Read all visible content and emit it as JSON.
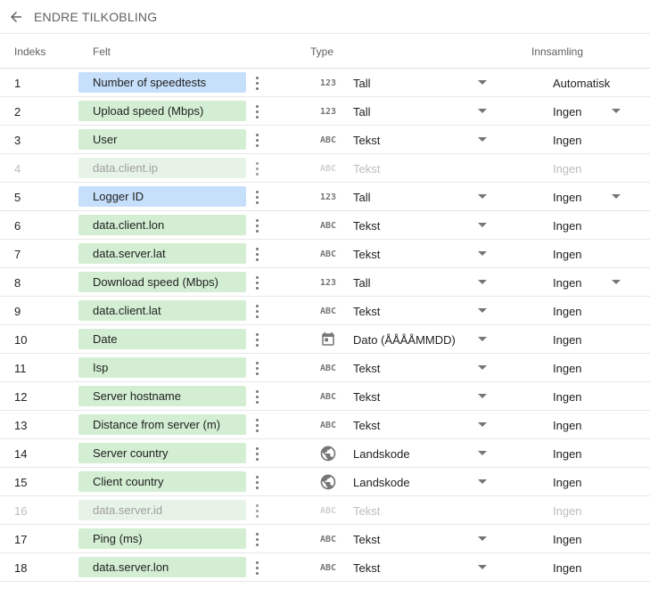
{
  "header": {
    "title": "ENDRE TILKOBLING",
    "back_icon": "arrow-left-icon"
  },
  "columns": {
    "index": "Indeks",
    "field": "Felt",
    "type": "Type",
    "aggregation": "Innsamling"
  },
  "rows": [
    {
      "index": "1",
      "field": "Number of speedtests",
      "kind": "metric",
      "type_icon": "123",
      "type": "Tall",
      "aggregation": "Automatisk",
      "disabled": false,
      "type_dropdown": true,
      "agg_dropdown": false
    },
    {
      "index": "2",
      "field": "Upload speed (Mbps)",
      "kind": "dim",
      "type_icon": "123",
      "type": "Tall",
      "aggregation": "Ingen",
      "disabled": false,
      "type_dropdown": true,
      "agg_dropdown": true
    },
    {
      "index": "3",
      "field": "User",
      "kind": "dim",
      "type_icon": "ABC",
      "type": "Tekst",
      "aggregation": "Ingen",
      "disabled": false,
      "type_dropdown": true,
      "agg_dropdown": false
    },
    {
      "index": "4",
      "field": "data.client.ip",
      "kind": "dim",
      "type_icon": "ABC",
      "type": "Tekst",
      "aggregation": "Ingen",
      "disabled": true,
      "type_dropdown": false,
      "agg_dropdown": false
    },
    {
      "index": "5",
      "field": "Logger ID",
      "kind": "metric",
      "type_icon": "123",
      "type": "Tall",
      "aggregation": "Ingen",
      "disabled": false,
      "type_dropdown": true,
      "agg_dropdown": true
    },
    {
      "index": "6",
      "field": "data.client.lon",
      "kind": "dim",
      "type_icon": "ABC",
      "type": "Tekst",
      "aggregation": "Ingen",
      "disabled": false,
      "type_dropdown": true,
      "agg_dropdown": false
    },
    {
      "index": "7",
      "field": "data.server.lat",
      "kind": "dim",
      "type_icon": "ABC",
      "type": "Tekst",
      "aggregation": "Ingen",
      "disabled": false,
      "type_dropdown": true,
      "agg_dropdown": false
    },
    {
      "index": "8",
      "field": "Download speed (Mbps)",
      "kind": "dim",
      "type_icon": "123",
      "type": "Tall",
      "aggregation": "Ingen",
      "disabled": false,
      "type_dropdown": true,
      "agg_dropdown": true
    },
    {
      "index": "9",
      "field": "data.client.lat",
      "kind": "dim",
      "type_icon": "ABC",
      "type": "Tekst",
      "aggregation": "Ingen",
      "disabled": false,
      "type_dropdown": true,
      "agg_dropdown": false
    },
    {
      "index": "10",
      "field": "Date",
      "kind": "dim",
      "type_icon": "calendar",
      "type": "Dato (ÅÅÅÅMMDD)",
      "aggregation": "Ingen",
      "disabled": false,
      "type_dropdown": true,
      "agg_dropdown": false
    },
    {
      "index": "11",
      "field": "Isp",
      "kind": "dim",
      "type_icon": "ABC",
      "type": "Tekst",
      "aggregation": "Ingen",
      "disabled": false,
      "type_dropdown": true,
      "agg_dropdown": false
    },
    {
      "index": "12",
      "field": "Server hostname",
      "kind": "dim",
      "type_icon": "ABC",
      "type": "Tekst",
      "aggregation": "Ingen",
      "disabled": false,
      "type_dropdown": true,
      "agg_dropdown": false
    },
    {
      "index": "13",
      "field": "Distance from server (m)",
      "kind": "dim",
      "type_icon": "ABC",
      "type": "Tekst",
      "aggregation": "Ingen",
      "disabled": false,
      "type_dropdown": true,
      "agg_dropdown": false
    },
    {
      "index": "14",
      "field": "Server country",
      "kind": "dim",
      "type_icon": "globe",
      "type": "Landskode",
      "aggregation": "Ingen",
      "disabled": false,
      "type_dropdown": true,
      "agg_dropdown": false
    },
    {
      "index": "15",
      "field": "Client country",
      "kind": "dim",
      "type_icon": "globe",
      "type": "Landskode",
      "aggregation": "Ingen",
      "disabled": false,
      "type_dropdown": true,
      "agg_dropdown": false
    },
    {
      "index": "16",
      "field": "data.server.id",
      "kind": "dim",
      "type_icon": "ABC",
      "type": "Tekst",
      "aggregation": "Ingen",
      "disabled": true,
      "type_dropdown": false,
      "agg_dropdown": false
    },
    {
      "index": "17",
      "field": "Ping (ms)",
      "kind": "dim",
      "type_icon": "ABC",
      "type": "Tekst",
      "aggregation": "Ingen",
      "disabled": false,
      "type_dropdown": true,
      "agg_dropdown": false
    },
    {
      "index": "18",
      "field": "data.server.lon",
      "kind": "dim",
      "type_icon": "ABC",
      "type": "Tekst",
      "aggregation": "Ingen",
      "disabled": false,
      "type_dropdown": true,
      "agg_dropdown": false
    }
  ]
}
